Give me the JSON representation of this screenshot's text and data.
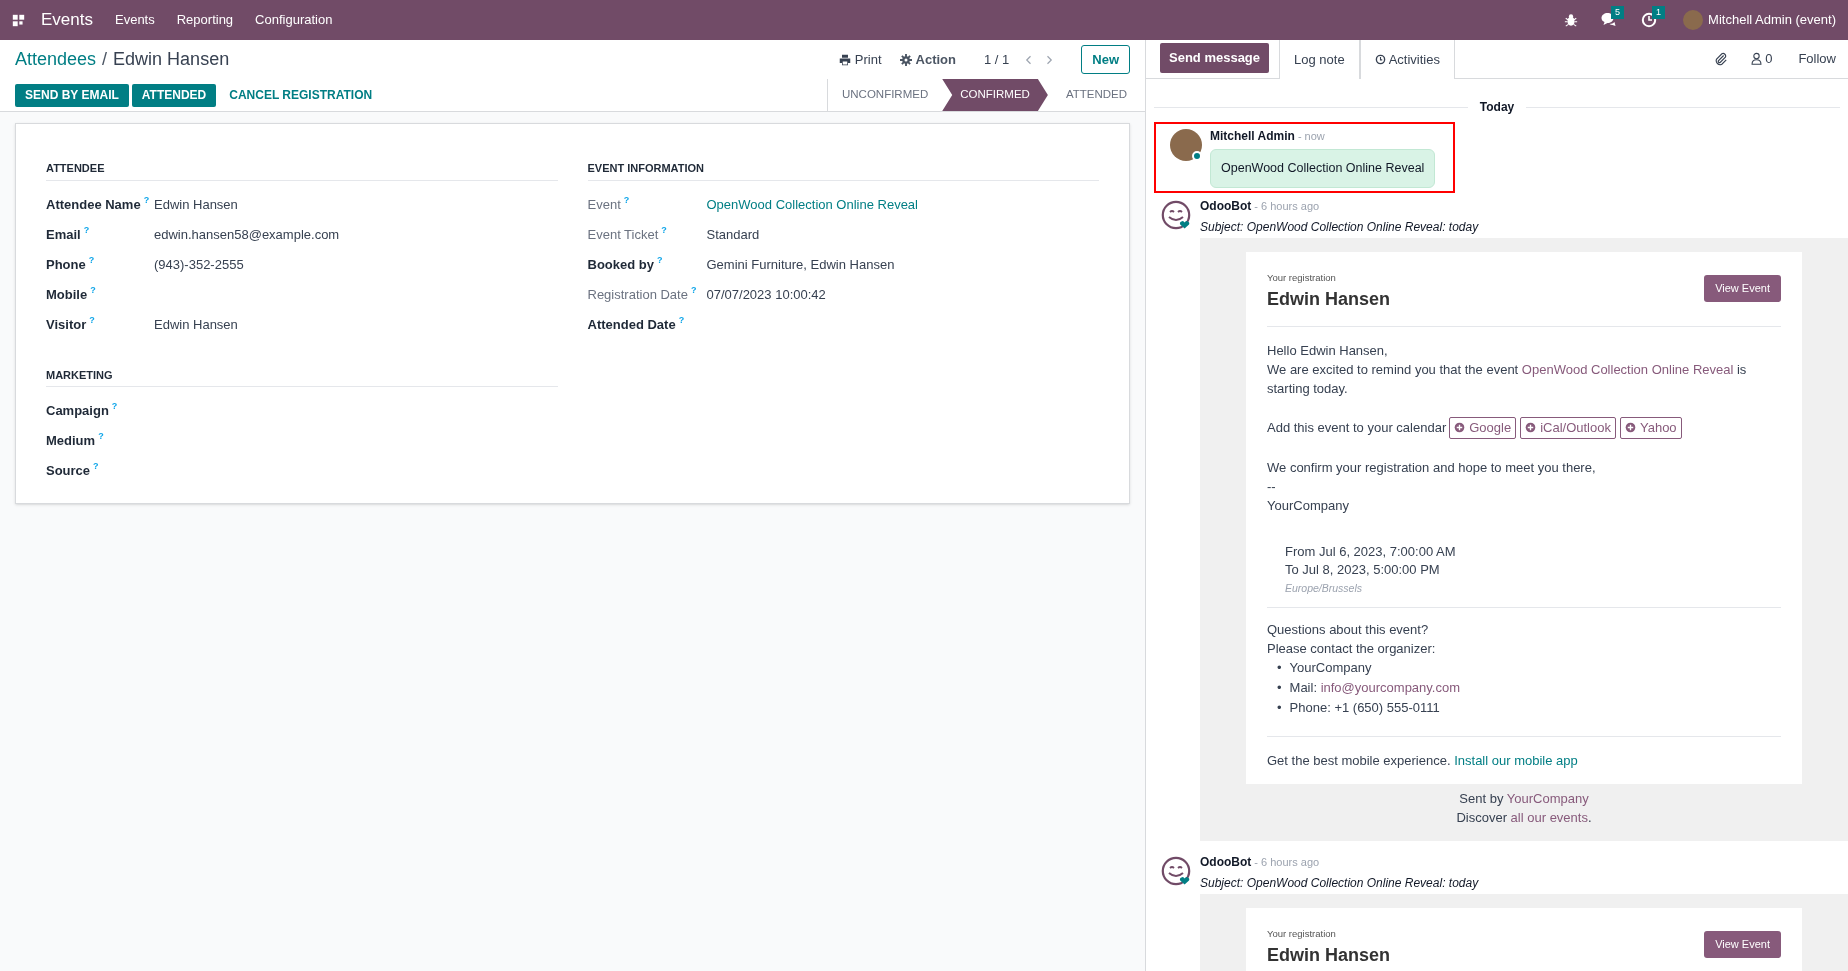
{
  "navbar": {
    "app_name": "Events",
    "menu": [
      "Events",
      "Reporting",
      "Configuration"
    ],
    "messages_count": "5",
    "activities_count": "1",
    "user": "Mitchell Admin (event)"
  },
  "control_panel": {
    "breadcrumb": "Attendees",
    "separator": "/",
    "record": "Edwin Hansen",
    "print": "Print",
    "action": "Action",
    "pager": "1 / 1",
    "new": "New"
  },
  "header_buttons": [
    {
      "label": "SEND BY EMAIL",
      "kind": "primary"
    },
    {
      "label": "ATTENDED",
      "kind": "primary"
    },
    {
      "label": "CANCEL REGISTRATION",
      "kind": "link"
    }
  ],
  "stages": [
    {
      "label": "UNCONFIRMED",
      "selected": false
    },
    {
      "label": "CONFIRMED",
      "selected": true
    },
    {
      "label": "ATTENDED",
      "selected": false
    }
  ],
  "form": {
    "columns": [
      [
        {
          "title": "ATTENDEE",
          "fields": [
            {
              "label": "Attendee Name",
              "help": "?",
              "readonly": false,
              "value": "Edwin Hansen",
              "link": false
            },
            {
              "label": "Email",
              "help": "?",
              "readonly": false,
              "value": "edwin.hansen58@example.com",
              "link": false
            },
            {
              "label": "Phone",
              "help": "?",
              "readonly": false,
              "value": "(943)-352-2555",
              "link": false
            },
            {
              "label": "Mobile",
              "help": "?",
              "readonly": false
            },
            {
              "label": "Visitor",
              "help": "?",
              "readonly": false,
              "value": "Edwin Hansen",
              "link": false
            }
          ]
        },
        {
          "title": "MARKETING",
          "fields": [
            {
              "label": "Campaign",
              "help": "?",
              "readonly": false
            },
            {
              "label": "Medium",
              "help": "?",
              "readonly": false
            },
            {
              "label": "Source",
              "help": "?",
              "readonly": false
            }
          ]
        }
      ],
      [
        {
          "title": "EVENT INFORMATION",
          "fields": [
            {
              "label": "Event",
              "help": "?",
              "readonly": true,
              "value": "OpenWood Collection Online Reveal",
              "link": true
            },
            {
              "label": "Event Ticket",
              "help": "?",
              "readonly": true,
              "value": "Standard",
              "link": false
            },
            {
              "label": "Booked by",
              "help": "?",
              "readonly": false,
              "value": "Gemini Furniture, Edwin Hansen",
              "link": false
            },
            {
              "label": "Registration Date",
              "help": "?",
              "readonly": true,
              "value": "07/07/2023 10:00:42",
              "link": false
            },
            {
              "label": "Attended Date",
              "help": "?",
              "readonly": false
            }
          ]
        }
      ]
    ]
  },
  "chatter": {
    "buttons": [
      {
        "label": "Send message",
        "kind": "primary"
      },
      {
        "label": "Log note",
        "kind": "tab"
      },
      {
        "label": "Activities",
        "kind": "tab"
      }
    ],
    "followers_count": "0",
    "follow": "Follow",
    "date_separator": "Today",
    "messages": [
      {
        "kind": "note",
        "online": true,
        "highlighted": true,
        "author": "Mitchell Admin",
        "time": "- now",
        "body": "OpenWood Collection Online Reveal"
      },
      {
        "kind": "email",
        "author": "OdooBot",
        "time": "- 6 hours ago",
        "subject": "Subject: OpenWood Collection Online Reveal: today",
        "email": {
          "eyebrow": "Your registration",
          "name": "Edwin Hansen",
          "button": "View Event",
          "greeting": "Hello Edwin Hansen,",
          "intro": [
            {
              "text": "We are excited to remind you that the event ",
              "kind": "text"
            },
            {
              "text": "OpenWood Collection Online Reveal",
              "kind": "link"
            },
            {
              "text": " is starting today.",
              "kind": "text"
            }
          ],
          "calendar_label": "Add this event to your calendar",
          "calendar_buttons": [
            "Google",
            "iCal/Outlook",
            "Yahoo"
          ],
          "confirm": "We confirm your registration and hope to meet you there,",
          "dashes": "--",
          "signature": "YourCompany",
          "from": "From Jul 6, 2023, 7:00:00 AM",
          "to": "To Jul 8, 2023, 5:00:00 PM",
          "timezone": "Europe/Brussels",
          "questions": "Questions about this event?",
          "contact": "Please contact the organizer:",
          "contacts": [
            {
              "bullet": "•",
              "parts": [
                {
                  "text": "YourCompany",
                  "kind": "text"
                }
              ]
            },
            {
              "bullet": "•",
              "parts": [
                {
                  "text": "Mail: ",
                  "kind": "text"
                },
                {
                  "text": "info@yourcompany.com",
                  "kind": "link"
                }
              ]
            },
            {
              "bullet": "•",
              "parts": [
                {
                  "text": "Phone: +1 (650) 555-0111",
                  "kind": "text"
                }
              ]
            }
          ],
          "mobile": [
            {
              "text": "Get the best mobile experience. ",
              "kind": "text"
            },
            {
              "text": "Install our mobile app",
              "kind": "app_link"
            }
          ],
          "footer": [
            [
              {
                "text": "Sent by ",
                "kind": "text"
              },
              {
                "text": "YourCompany",
                "kind": "link"
              }
            ],
            [
              {
                "text": "Discover ",
                "kind": "text"
              },
              {
                "text": "all our events",
                "kind": "link"
              },
              {
                "text": ".",
                "kind": "text"
              }
            ]
          ]
        }
      },
      {
        "kind": "email",
        "author": "OdooBot",
        "time": "- 6 hours ago",
        "subject": "Subject: OpenWood Collection Online Reveal: today",
        "email": {
          "eyebrow": "Your registration",
          "name": "Edwin Hansen",
          "button": "View Event"
        }
      }
    ]
  }
}
